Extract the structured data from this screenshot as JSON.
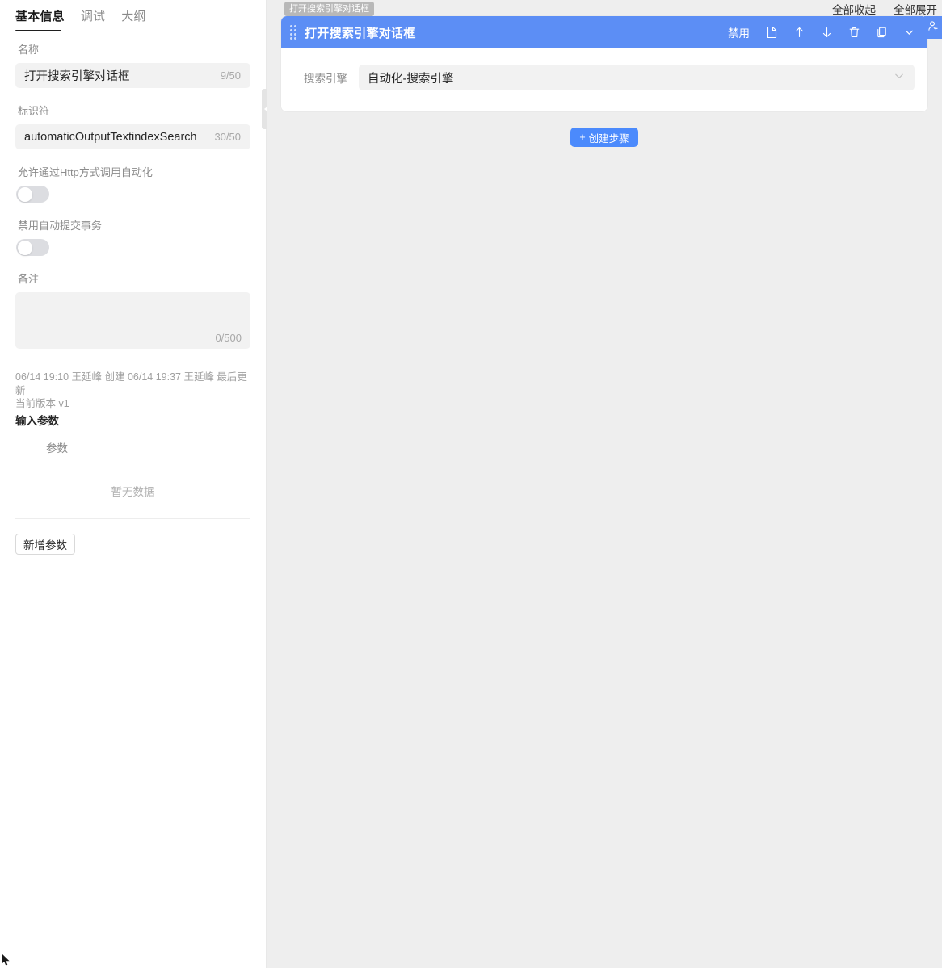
{
  "sidebar": {
    "tabs": [
      {
        "label": "基本信息",
        "active": true
      },
      {
        "label": "调试",
        "active": false
      },
      {
        "label": "大纲",
        "active": false
      }
    ],
    "fields": {
      "name_label": "名称",
      "name_value": "打开搜索引擎对话框",
      "name_counter": "9/50",
      "ident_label": "标识符",
      "ident_value": "automaticOutputTextindexSearch",
      "ident_counter": "30/50",
      "http_label": "允许通过Http方式调用自动化",
      "http_switch_state": "off",
      "txn_label": "禁用自动提交事务",
      "txn_switch_state": "off",
      "remark_label": "备注",
      "remark_value": "",
      "remark_counter": "0/500"
    },
    "meta": {
      "line1": "06/14 19:10 王延峰 创建 06/14 19:37 王延峰 最后更新",
      "line2": "当前版本 v1"
    },
    "params": {
      "section_title": "输入参数",
      "column_header": "参数",
      "empty_text": "暂无数据",
      "add_button": "新增参数"
    },
    "collapse_handle_icon": "triangle-left-icon"
  },
  "right": {
    "top_links": [
      {
        "label": "全部收起",
        "name": "collapse-all-link"
      },
      {
        "label": "全部展开",
        "name": "expand-all-link"
      }
    ],
    "tooltip": "打开搜索引擎对话框",
    "card": {
      "title": "打开搜索引擎对话框",
      "header_color": "#5c8ef5",
      "drag_handle_icon": "drag-dots-icon",
      "actions": [
        {
          "label": "禁用",
          "name": "disable-button",
          "type": "text"
        },
        {
          "label": "",
          "name": "document-icon",
          "type": "icon"
        },
        {
          "label": "",
          "name": "arrow-up-icon",
          "type": "icon"
        },
        {
          "label": "",
          "name": "arrow-down-icon",
          "type": "icon"
        },
        {
          "label": "",
          "name": "trash-icon",
          "type": "icon"
        },
        {
          "label": "",
          "name": "copy-icon",
          "type": "icon"
        },
        {
          "label": "",
          "name": "chevron-down-icon",
          "type": "icon"
        }
      ],
      "form": {
        "field_label": "搜索引擎",
        "field_value": "自动化-搜索引擎",
        "chevron_icon": "chevron-down-icon"
      }
    },
    "add_step_button": {
      "plus": "+",
      "label": "创建步骤",
      "color": "#4b8afc"
    },
    "user_tab_icon": "user-add-icon",
    "background_color": "#eeeeee"
  }
}
